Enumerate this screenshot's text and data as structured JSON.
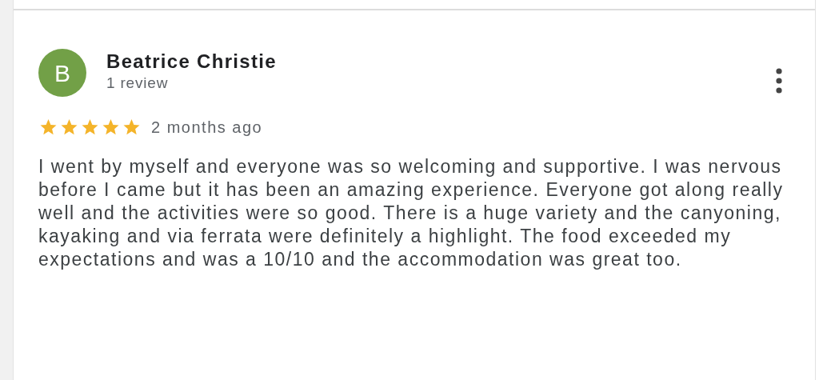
{
  "review": {
    "avatar_letter": "B",
    "author": "Beatrice Christie",
    "review_count": "1 review",
    "stars": 5,
    "date": "2 months ago",
    "text": "I went by myself and everyone was so welcoming and supportive. I was nervous before I came but it has been an amazing experience. Everyone got along really well and the activities were so good. There is a huge variety and the canyoning, kayaking and via ferrata were definitely a highlight. The food exceeded my expectations and was a 10/10 and the accommodation was great too."
  }
}
